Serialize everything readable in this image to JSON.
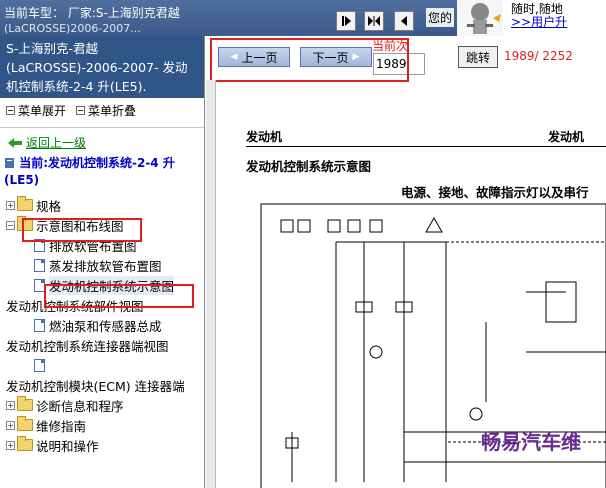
{
  "header": {
    "vehicle_line1": "当前车型： 厂家:S-上海别克君越",
    "vehicle_line2": "(LaCROSSE)2006-2007...",
    "yours_text": "您的",
    "top_right_line1": "随时,随地",
    "top_right_link": ">>用户升"
  },
  "sidebar": {
    "title": "S-上海别克-君越(LaCROSSE)-2006-2007- 发动机控制系统-2-4 升(LE5).",
    "expand_label": "菜单展开",
    "collapse_label": "菜单折叠",
    "back_label": "返回上一级",
    "current_label": "当前:发动机控制系统-2-4 升(LE5)",
    "tree": [
      {
        "label": "规格",
        "type": "folder"
      },
      {
        "label": "示意图和布线图",
        "type": "folder"
      },
      {
        "label": "排放软管布置图",
        "type": "doc"
      },
      {
        "label": "蒸发排放软管布置图",
        "type": "doc"
      },
      {
        "label": "发动机控制系统示意图",
        "type": "doc"
      },
      {
        "label": "发动机控制系统部件视图",
        "type": "text"
      },
      {
        "label": "燃油泵和传感器总成",
        "type": "doc"
      },
      {
        "label": "发动机控制系统连接器端视图",
        "type": "text"
      },
      {
        "label": "",
        "type": "doc"
      },
      {
        "label": "发动机控制模块(ECM) 连接器端",
        "type": "text"
      },
      {
        "label": "诊断信息和程序",
        "type": "folder"
      },
      {
        "label": "维修指南",
        "type": "folder"
      },
      {
        "label": "说明和操作",
        "type": "folder"
      }
    ]
  },
  "pager": {
    "prev_label": "上一页",
    "next_label": "下一页",
    "current_page_label": "当前次",
    "current_page_value": "1989",
    "jump_label": "跳转",
    "page_info": "1989/ 2252"
  },
  "document": {
    "header_left": "发动机",
    "header_right": "发动机",
    "title": "发动机控制系统示意图",
    "subtitle": "电源、接地、故障指示灯以及串行",
    "watermark": "畅易汽车维"
  },
  "colors": {
    "sidebar_title_bg": "#2f5686",
    "highlight_red": "#e02020",
    "link_blue": "#0000cc",
    "back_green": "#008000"
  }
}
